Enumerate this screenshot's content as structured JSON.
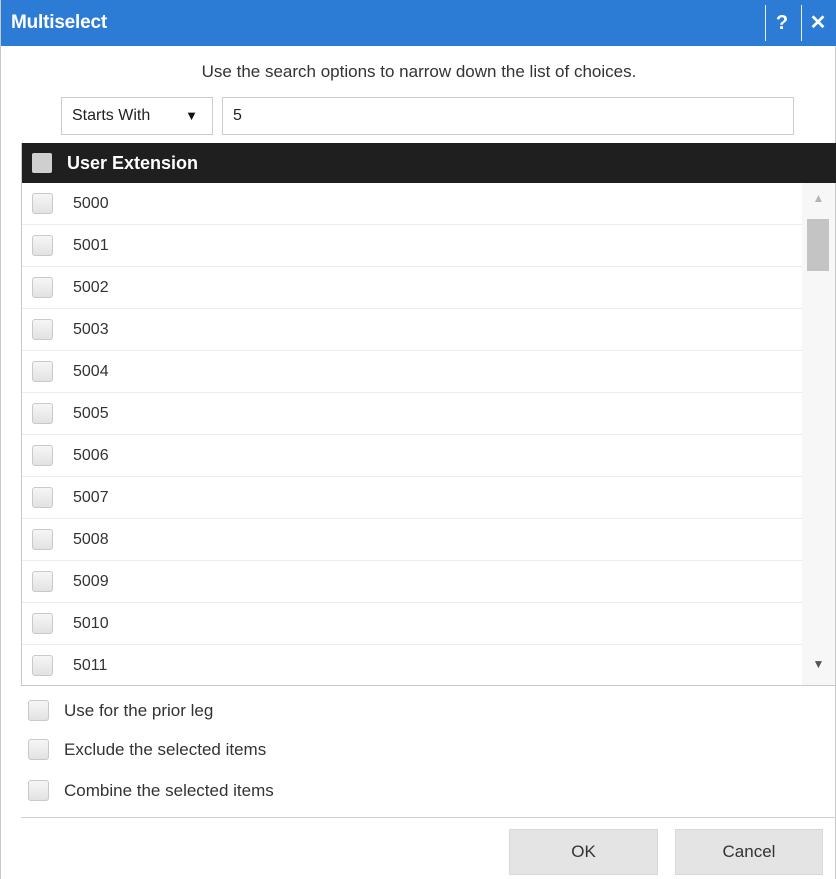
{
  "dialog": {
    "title": "Multiselect",
    "help_label": "?",
    "close_label": "✕"
  },
  "search": {
    "instructions": "Use the search options to narrow down the list of choices.",
    "mode": "Starts With",
    "mode_arrow": "▼",
    "value": "5"
  },
  "grid": {
    "header_label": "User Extension",
    "rows": [
      "5000",
      "5001",
      "5002",
      "5003",
      "5004",
      "5005",
      "5006",
      "5007",
      "5008",
      "5009",
      "5010",
      "5011"
    ],
    "scroll_up": "▲",
    "scroll_down": "▼"
  },
  "options": {
    "prior_leg": "Use for the prior leg",
    "exclude": "Exclude the selected items",
    "combine": "Combine the selected items"
  },
  "buttons": {
    "ok": "OK",
    "cancel": "Cancel"
  },
  "colors": {
    "titlebar": "#2c7bd4",
    "grid_header": "#1f1f1f",
    "button": "#e4e4e4"
  }
}
